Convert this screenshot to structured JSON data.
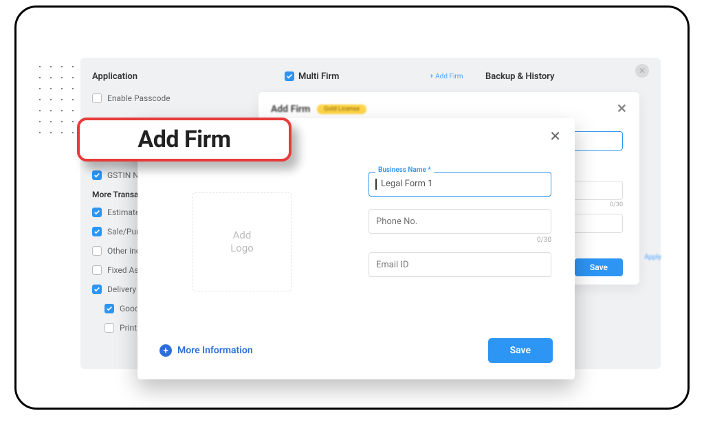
{
  "top": {
    "application": "Application",
    "multi_firm": "Multi Firm",
    "add_firm_link": "+ Add Firm",
    "backup": "Backup & History"
  },
  "sidebar": {
    "enable_passcode": "Enable Passcode",
    "gstin": "GSTIN Nu",
    "more_section": "More Transa",
    "estimate": "Estimate/",
    "sale_purchase": "Sale/Purch",
    "other_income": "Other inco",
    "fixed_asset": "Fixed Asse",
    "delivery": "Delivery C",
    "goods": "Goods",
    "print": "Print ar"
  },
  "dialog_back": {
    "title": "Add Firm",
    "badge": "Gold License",
    "counter": "0/30",
    "apply": "Apply",
    "save": "Save"
  },
  "highlight": {
    "title": "Add Firm"
  },
  "dialog_front": {
    "logo_line1": "Add",
    "logo_line2": "Logo",
    "business_label": "Business Name *",
    "business_value": "Legal Form 1",
    "phone_ph": "Phone No.",
    "phone_counter": "0/30",
    "email_ph": "Email ID",
    "more_info": "More Information",
    "save": "Save"
  }
}
